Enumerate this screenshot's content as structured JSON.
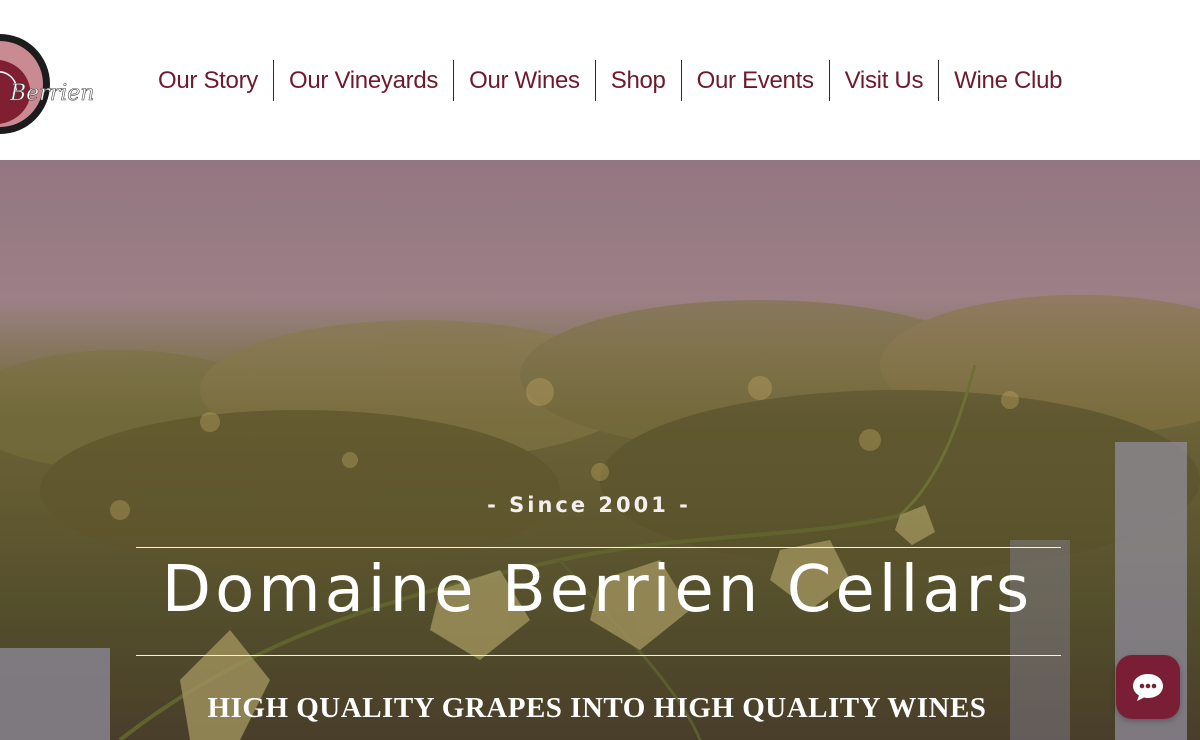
{
  "brand": {
    "logo_text": "Berrien Cellars"
  },
  "nav": {
    "items": [
      {
        "label": "Our Story"
      },
      {
        "label": "Our Vineyards"
      },
      {
        "label": "Our Wines"
      },
      {
        "label": "Shop"
      },
      {
        "label": "Our Events"
      },
      {
        "label": "Visit Us"
      },
      {
        "label": "Wine Club"
      }
    ]
  },
  "hero": {
    "since": "- Since 2001 -",
    "title": "Domaine Berrien Cellars",
    "tagline": "HIGH QUALITY GRAPES INTO HIGH QUALITY WINES"
  },
  "chat": {
    "icon": "chat-bubble-icon"
  },
  "colors": {
    "accent": "#6e1a2c",
    "chat_button": "#7a1e35",
    "logo_wine": "#9c3a48"
  }
}
